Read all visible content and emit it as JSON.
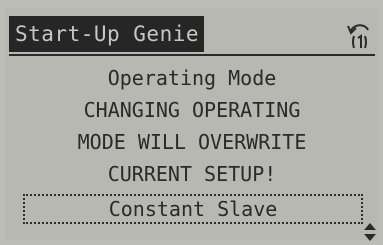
{
  "header": {
    "title": "Start-Up Genie",
    "back_icon": "back-arrow-icon"
  },
  "message": {
    "heading": "Operating Mode",
    "warning_line_1": "CHANGING OPERATING",
    "warning_line_2": "MODE WILL OVERWRITE",
    "warning_line_3": "CURRENT SETUP!"
  },
  "field": {
    "value": "Constant Slave"
  },
  "indicators": {
    "scroll_icon": "up-down-arrows-icon"
  },
  "colors": {
    "lcd_background": "#b6b8b1",
    "lcd_text": "#2a2a2a",
    "title_bar_background": "#262626"
  }
}
